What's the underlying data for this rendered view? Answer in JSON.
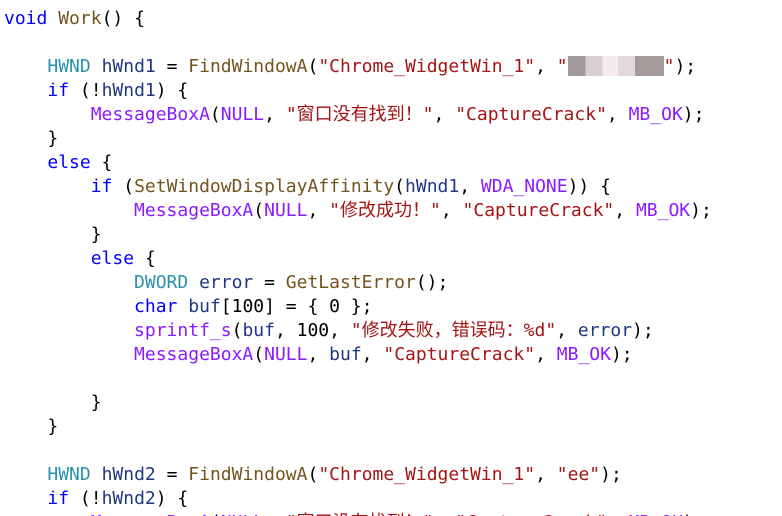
{
  "editor": {
    "colors": {
      "background": "#ffffff",
      "keyword": "#0000ff",
      "type": "#2b91af",
      "function": "#74531f",
      "string": "#a31515",
      "macro": "#8a1bff",
      "variable": "#1f377f",
      "plain": "#000000"
    },
    "lines": [
      {
        "tokens": [
          {
            "t": "kw",
            "v": "void"
          },
          {
            "t": "plain",
            "v": " "
          },
          {
            "t": "fn",
            "v": "Work"
          },
          {
            "t": "plain",
            "v": "() {"
          }
        ]
      },
      {
        "tokens": []
      },
      {
        "tokens": [
          {
            "t": "plain",
            "v": "    "
          },
          {
            "t": "type",
            "v": "HWND"
          },
          {
            "t": "plain",
            "v": " "
          },
          {
            "t": "var",
            "v": "hWnd1"
          },
          {
            "t": "plain",
            "v": " = "
          },
          {
            "t": "fn",
            "v": "FindWindowA"
          },
          {
            "t": "plain",
            "v": "("
          },
          {
            "t": "str",
            "v": "\"Chrome_WidgetWin_1\""
          },
          {
            "t": "plain",
            "v": ", "
          },
          {
            "t": "str",
            "v": "\""
          },
          {
            "t": "redact",
            "v": ""
          },
          {
            "t": "str",
            "v": "\""
          },
          {
            "t": "plain",
            "v": ");"
          }
        ]
      },
      {
        "tokens": [
          {
            "t": "plain",
            "v": "    "
          },
          {
            "t": "kw",
            "v": "if"
          },
          {
            "t": "plain",
            "v": " (!"
          },
          {
            "t": "var",
            "v": "hWnd1"
          },
          {
            "t": "plain",
            "v": ") {"
          }
        ]
      },
      {
        "tokens": [
          {
            "t": "plain",
            "v": "        "
          },
          {
            "t": "macro",
            "v": "MessageBoxA"
          },
          {
            "t": "plain",
            "v": "("
          },
          {
            "t": "macro",
            "v": "NULL"
          },
          {
            "t": "plain",
            "v": ", "
          },
          {
            "t": "str",
            "v": "\"窗口没有找到！\""
          },
          {
            "t": "plain",
            "v": ", "
          },
          {
            "t": "str",
            "v": "\"CaptureCrack\""
          },
          {
            "t": "plain",
            "v": ", "
          },
          {
            "t": "macro",
            "v": "MB_OK"
          },
          {
            "t": "plain",
            "v": ");"
          }
        ]
      },
      {
        "tokens": [
          {
            "t": "plain",
            "v": "    }"
          }
        ]
      },
      {
        "tokens": [
          {
            "t": "plain",
            "v": "    "
          },
          {
            "t": "kw",
            "v": "else"
          },
          {
            "t": "plain",
            "v": " {"
          }
        ]
      },
      {
        "tokens": [
          {
            "t": "plain",
            "v": "        "
          },
          {
            "t": "kw",
            "v": "if"
          },
          {
            "t": "plain",
            "v": " ("
          },
          {
            "t": "fn",
            "v": "SetWindowDisplayAffinity"
          },
          {
            "t": "plain",
            "v": "("
          },
          {
            "t": "var",
            "v": "hWnd1"
          },
          {
            "t": "plain",
            "v": ", "
          },
          {
            "t": "macro",
            "v": "WDA_NONE"
          },
          {
            "t": "plain",
            "v": ")) {"
          }
        ]
      },
      {
        "tokens": [
          {
            "t": "plain",
            "v": "            "
          },
          {
            "t": "macro",
            "v": "MessageBoxA"
          },
          {
            "t": "plain",
            "v": "("
          },
          {
            "t": "macro",
            "v": "NULL"
          },
          {
            "t": "plain",
            "v": ", "
          },
          {
            "t": "str",
            "v": "\"修改成功！\""
          },
          {
            "t": "plain",
            "v": ", "
          },
          {
            "t": "str",
            "v": "\"CaptureCrack\""
          },
          {
            "t": "plain",
            "v": ", "
          },
          {
            "t": "macro",
            "v": "MB_OK"
          },
          {
            "t": "plain",
            "v": ");"
          }
        ]
      },
      {
        "tokens": [
          {
            "t": "plain",
            "v": "        }"
          }
        ]
      },
      {
        "tokens": [
          {
            "t": "plain",
            "v": "        "
          },
          {
            "t": "kw",
            "v": "else"
          },
          {
            "t": "plain",
            "v": " {"
          }
        ]
      },
      {
        "tokens": [
          {
            "t": "plain",
            "v": "            "
          },
          {
            "t": "type",
            "v": "DWORD"
          },
          {
            "t": "plain",
            "v": " "
          },
          {
            "t": "var",
            "v": "error"
          },
          {
            "t": "plain",
            "v": " = "
          },
          {
            "t": "fn",
            "v": "GetLastError"
          },
          {
            "t": "plain",
            "v": "();"
          }
        ]
      },
      {
        "tokens": [
          {
            "t": "plain",
            "v": "            "
          },
          {
            "t": "kw",
            "v": "char"
          },
          {
            "t": "plain",
            "v": " "
          },
          {
            "t": "var",
            "v": "buf"
          },
          {
            "t": "plain",
            "v": "[100] = { 0 };"
          }
        ]
      },
      {
        "tokens": [
          {
            "t": "plain",
            "v": "            "
          },
          {
            "t": "macro",
            "v": "sprintf_s"
          },
          {
            "t": "plain",
            "v": "("
          },
          {
            "t": "var",
            "v": "buf"
          },
          {
            "t": "plain",
            "v": ", 100, "
          },
          {
            "t": "str",
            "v": "\"修改失败，错误码：%d\""
          },
          {
            "t": "plain",
            "v": ", "
          },
          {
            "t": "var",
            "v": "error"
          },
          {
            "t": "plain",
            "v": ");"
          }
        ]
      },
      {
        "tokens": [
          {
            "t": "plain",
            "v": "            "
          },
          {
            "t": "macro",
            "v": "MessageBoxA"
          },
          {
            "t": "plain",
            "v": "("
          },
          {
            "t": "macro",
            "v": "NULL"
          },
          {
            "t": "plain",
            "v": ", "
          },
          {
            "t": "var",
            "v": "buf"
          },
          {
            "t": "plain",
            "v": ", "
          },
          {
            "t": "str",
            "v": "\"CaptureCrack\""
          },
          {
            "t": "plain",
            "v": ", "
          },
          {
            "t": "macro",
            "v": "MB_OK"
          },
          {
            "t": "plain",
            "v": ");"
          }
        ]
      },
      {
        "tokens": []
      },
      {
        "tokens": [
          {
            "t": "plain",
            "v": "        }"
          }
        ]
      },
      {
        "tokens": [
          {
            "t": "plain",
            "v": "    }"
          }
        ]
      },
      {
        "tokens": []
      },
      {
        "tokens": [
          {
            "t": "plain",
            "v": "    "
          },
          {
            "t": "type",
            "v": "HWND"
          },
          {
            "t": "plain",
            "v": " "
          },
          {
            "t": "var",
            "v": "hWnd2"
          },
          {
            "t": "plain",
            "v": " = "
          },
          {
            "t": "fn",
            "v": "FindWindowA"
          },
          {
            "t": "plain",
            "v": "("
          },
          {
            "t": "str",
            "v": "\"Chrome_WidgetWin_1\""
          },
          {
            "t": "plain",
            "v": ", "
          },
          {
            "t": "str",
            "v": "\"ee\""
          },
          {
            "t": "plain",
            "v": ");"
          }
        ]
      },
      {
        "tokens": [
          {
            "t": "plain",
            "v": "    "
          },
          {
            "t": "kw",
            "v": "if"
          },
          {
            "t": "plain",
            "v": " (!"
          },
          {
            "t": "var",
            "v": "hWnd2"
          },
          {
            "t": "plain",
            "v": ") {"
          }
        ]
      },
      {
        "tokens": [
          {
            "t": "plain",
            "v": "        "
          },
          {
            "t": "macro",
            "v": "MessageBoxA"
          },
          {
            "t": "plain",
            "v": "("
          },
          {
            "t": "macro",
            "v": "NULL"
          },
          {
            "t": "plain",
            "v": ", "
          },
          {
            "t": "str",
            "v": "\"窗口没有找到！\""
          },
          {
            "t": "plain",
            "v": ", "
          },
          {
            "t": "str",
            "v": "\"CaptureCrack\""
          },
          {
            "t": "plain",
            "v": ", "
          },
          {
            "t": "macro",
            "v": "MB_OK"
          },
          {
            "t": "plain",
            "v": ");"
          }
        ]
      }
    ]
  }
}
